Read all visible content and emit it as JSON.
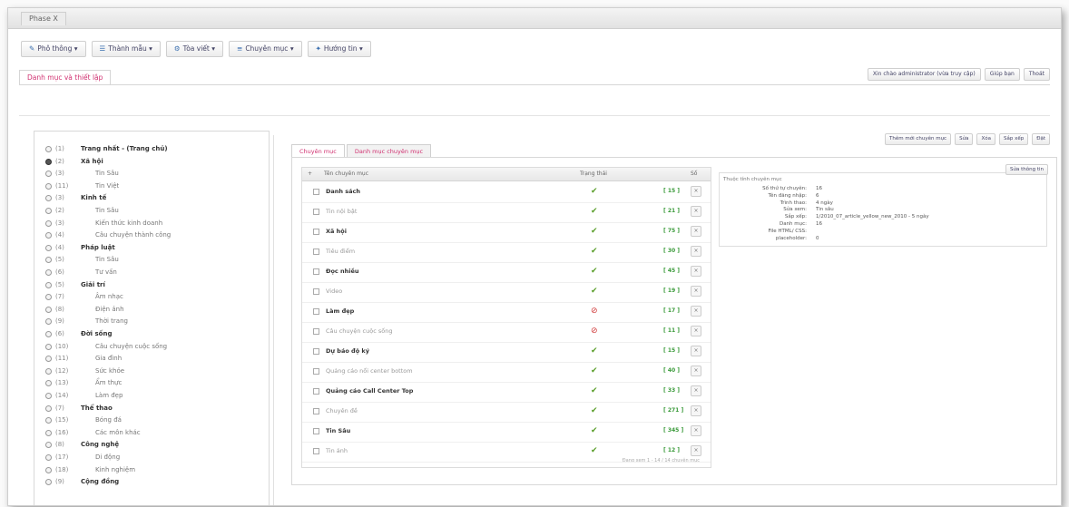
{
  "window": {
    "tab_title": "Phase X"
  },
  "toolbar": [
    {
      "icon": "pencil-icon",
      "label": "Phô thông"
    },
    {
      "icon": "list-icon",
      "label": "Thành mẫu"
    },
    {
      "icon": "gear-icon",
      "label": "Tòa viết"
    },
    {
      "icon": "bars-icon",
      "label": "Chuyên mục"
    },
    {
      "icon": "wrench-icon",
      "label": "Hướng tin"
    }
  ],
  "page_tab": "Danh mục và thiết lập",
  "top_right_tools": [
    "Xin chào administrator (vừa truy cập)",
    "Giúp bạn",
    "Thoát"
  ],
  "sidebar": {
    "items": [
      {
        "id": "(1)",
        "label": "Trang nhất - (Trang chủ)",
        "level": "top",
        "checked": false
      },
      {
        "id": "(2)",
        "label": "Xã hội",
        "level": "top",
        "checked": true
      },
      {
        "id": "(3)",
        "label": "Tin Sâu",
        "level": "sub",
        "checked": false
      },
      {
        "id": "(11)",
        "label": "Tin Việt",
        "level": "sub",
        "checked": false
      },
      {
        "id": "(3)",
        "label": "Kinh tế",
        "level": "top",
        "checked": false
      },
      {
        "id": "(2)",
        "label": "Tin Sâu",
        "level": "sub",
        "checked": false
      },
      {
        "id": "(3)",
        "label": "Kiến thức kinh doanh",
        "level": "sub",
        "checked": false
      },
      {
        "id": "(4)",
        "label": "Câu chuyện thành công",
        "level": "sub",
        "checked": false
      },
      {
        "id": "(4)",
        "label": "Pháp luật",
        "level": "top",
        "checked": false
      },
      {
        "id": "(5)",
        "label": "Tin Sâu",
        "level": "sub",
        "checked": false
      },
      {
        "id": "(6)",
        "label": "Tư vấn",
        "level": "sub",
        "checked": false
      },
      {
        "id": "(5)",
        "label": "Giải trí",
        "level": "top",
        "checked": false
      },
      {
        "id": "(7)",
        "label": "Âm nhạc",
        "level": "sub",
        "checked": false
      },
      {
        "id": "(8)",
        "label": "Điện ảnh",
        "level": "sub",
        "checked": false
      },
      {
        "id": "(9)",
        "label": "Thời trang",
        "level": "sub",
        "checked": false
      },
      {
        "id": "(6)",
        "label": "Đời sống",
        "level": "top",
        "checked": false
      },
      {
        "id": "(10)",
        "label": "Câu chuyện cuộc sống",
        "level": "sub",
        "checked": false
      },
      {
        "id": "(11)",
        "label": "Gia đình",
        "level": "sub",
        "checked": false
      },
      {
        "id": "(12)",
        "label": "Sức khỏe",
        "level": "sub",
        "checked": false
      },
      {
        "id": "(13)",
        "label": "Ẩm thực",
        "level": "sub",
        "checked": false
      },
      {
        "id": "(14)",
        "label": "Làm đẹp",
        "level": "sub",
        "checked": false
      },
      {
        "id": "(7)",
        "label": "Thể thao",
        "level": "top",
        "checked": false
      },
      {
        "id": "(15)",
        "label": "Bóng đá",
        "level": "sub",
        "checked": false
      },
      {
        "id": "(16)",
        "label": "Các môn khác",
        "level": "sub",
        "checked": false
      },
      {
        "id": "(8)",
        "label": "Công nghệ",
        "level": "top",
        "checked": false
      },
      {
        "id": "(17)",
        "label": "Di động",
        "level": "sub",
        "checked": false
      },
      {
        "id": "(18)",
        "label": "Kinh nghiệm",
        "level": "sub",
        "checked": false
      },
      {
        "id": "(9)",
        "label": "Cộng đồng",
        "level": "top",
        "checked": false
      }
    ]
  },
  "content_tools": [
    "Thêm mới chuyên mục",
    "Sửa",
    "Xóa",
    "Sắp xếp",
    "Đặt"
  ],
  "content_tabs": [
    "Chuyên mục",
    "Danh mục chuyên mục"
  ],
  "grid": {
    "headers": [
      "Tên chuyên mục",
      "Trạng thái",
      "Số"
    ],
    "rows": [
      {
        "name": "Danh sách",
        "style": "bold",
        "status": "ok",
        "num": "[ 15 ]"
      },
      {
        "name": "Tin nội bật",
        "style": "normal",
        "status": "ok",
        "num": "[ 21 ]"
      },
      {
        "name": "Xã hội",
        "style": "bold",
        "status": "ok",
        "num": "[ 75 ]"
      },
      {
        "name": "Tiêu điểm",
        "style": "normal",
        "status": "ok",
        "num": "[ 30 ]"
      },
      {
        "name": "Đọc nhiều",
        "style": "bold",
        "status": "ok",
        "num": "[ 45 ]"
      },
      {
        "name": "Video",
        "style": "normal",
        "status": "ok",
        "num": "[ 19 ]"
      },
      {
        "name": "Làm đẹp",
        "style": "bold",
        "status": "err",
        "num": "[ 17 ]"
      },
      {
        "name": "Câu chuyện cuộc sống",
        "style": "normal",
        "status": "err",
        "num": "[ 11 ]"
      },
      {
        "name": "Dự báo độ ký",
        "style": "bold",
        "status": "ok",
        "num": "[ 15 ]"
      },
      {
        "name": "Quảng cáo nổi center bottom",
        "style": "normal",
        "status": "ok",
        "num": "[ 40 ]"
      },
      {
        "name": "Quảng cáo Call Center Top",
        "style": "bold",
        "status": "ok",
        "num": "[ 33 ]"
      },
      {
        "name": "Chuyên đề",
        "style": "normal",
        "status": "ok",
        "num": "[ 271 ]"
      },
      {
        "name": "Tin Sâu",
        "style": "bold",
        "status": "ok",
        "num": "[ 345 ]"
      },
      {
        "name": "Tin ảnh",
        "style": "normal",
        "status": "ok",
        "num": "[ 12 ]"
      }
    ],
    "footer": "Đang xem 1 - 14 / 14 chuyên mục"
  },
  "info": {
    "title": "Thuộc tính chuyên mục",
    "edit_label": "Sửa thông tin",
    "fields": [
      {
        "k": "Số thứ tự chuyên:",
        "v": "16"
      },
      {
        "k": "Tên đăng nhập:",
        "v": "6"
      },
      {
        "k": "Trình thao:",
        "v": "4 ngày"
      },
      {
        "k": "Sửa xem:",
        "v": "Tin sâu"
      },
      {
        "k": "Sắp xếp:",
        "v": "1/2010_07_article_yellow_new_2010 - 5 ngày"
      },
      {
        "k": "Danh mục:",
        "v": "16"
      },
      {
        "k": "File HTML/ CSS:",
        "v": ""
      },
      {
        "k": "placeholder:",
        "v": "0"
      }
    ]
  },
  "colors": {
    "accent_pink": "#d03070",
    "ok_green": "#5a9e2a",
    "err_red": "#d03a3a"
  }
}
